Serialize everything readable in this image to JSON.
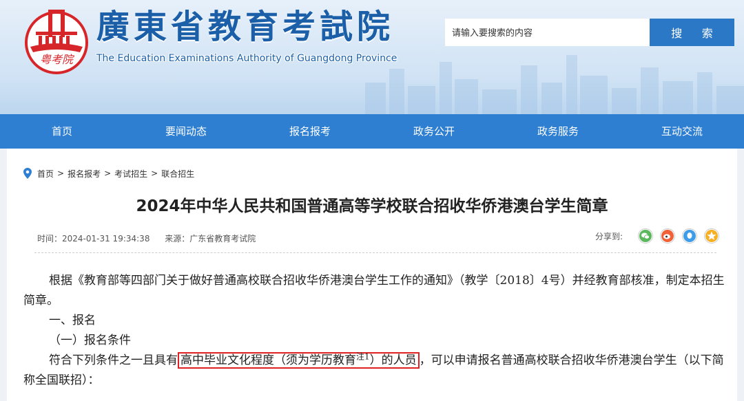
{
  "header": {
    "title_cn": "廣東省教育考試院",
    "title_en": "The Education Examinations Authority of Guangdong Province",
    "emblem_text": "粤考院",
    "search_placeholder": "请输入要搜索的内容",
    "search_button": "搜 索"
  },
  "nav": {
    "items": [
      "首页",
      "要闻动态",
      "报名报考",
      "政务公开",
      "政务服务",
      "互动交流"
    ]
  },
  "breadcrumb": {
    "items": [
      "首页",
      "报名报考",
      "考试招生",
      "联合招生"
    ],
    "separator": ">"
  },
  "article": {
    "title": "2024年中华人民共和国普通高等学校联合招收华侨港澳台学生简章",
    "time": "时间：2024-01-31 19:34:38",
    "source": "来源：广东省教育考试院",
    "share_label": "分享到:",
    "share_icons": [
      "wechat-icon",
      "weibo-icon",
      "qq-icon",
      "qzone-icon"
    ],
    "para1": "根据《教育部等四部门关于做好普通高校联合招收华侨港澳台学生工作的通知》（教学〔2018〕4号）并经教育部核准，制定本招生简章。",
    "heading1": "一、报名",
    "heading2": "（一）报名条件",
    "para2_before": "符合下列条件之一且具有",
    "para2_highlight": "高中毕业文化程度（须为学历教育",
    "para2_sup": "注1",
    "para2_highlight_after": "）的人员",
    "para2_after": "，可以申请报名普通高校联合招收华侨港澳台学生（以下简称全国联招）："
  },
  "colors": {
    "nav_bg": "#2e7fd1",
    "search_button": "#2b79c6",
    "title_blue": "#1b5fa8",
    "highlight_border": "#e02020"
  }
}
